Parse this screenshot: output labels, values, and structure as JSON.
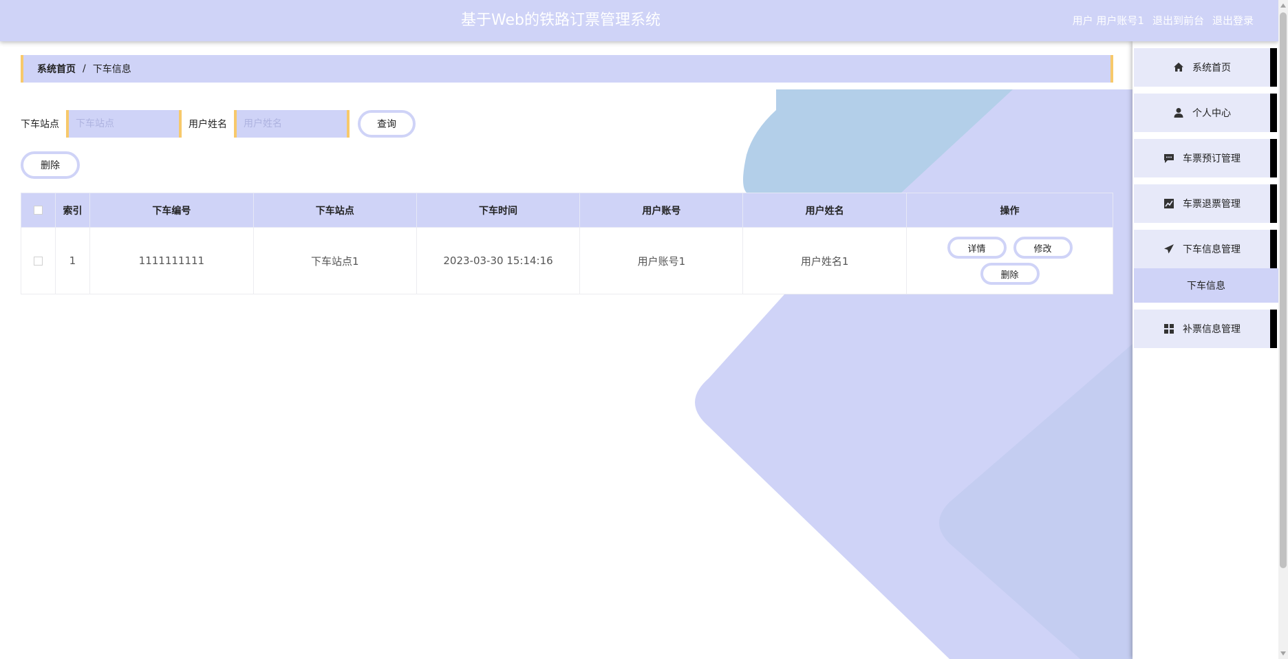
{
  "header": {
    "title": "基于Web的铁路订票管理系统",
    "user_label": "用户 用户账号1",
    "front_link": "退出到前台",
    "logout_link": "退出登录"
  },
  "breadcrumb": {
    "home": "系统首页",
    "separator": "/",
    "current": "下车信息"
  },
  "search": {
    "station_label": "下车站点",
    "station_placeholder": "下车站点",
    "name_label": "用户姓名",
    "name_placeholder": "用户姓名",
    "query_button": "查询"
  },
  "delete_button": "删除",
  "table": {
    "headers": [
      "索引",
      "下车编号",
      "下车站点",
      "下车时间",
      "用户账号",
      "用户姓名",
      "操作"
    ],
    "rows": [
      {
        "index": "1",
        "number": "1111111111",
        "station": "下车站点1",
        "time": "2023-03-30 15:14:16",
        "account": "用户账号1",
        "name": "用户姓名1",
        "actions": {
          "detail": "详情",
          "edit": "修改",
          "delete": "删除"
        }
      }
    ]
  },
  "sidebar": {
    "items": [
      {
        "label": "系统首页",
        "icon": "home-icon"
      },
      {
        "label": "个人中心",
        "icon": "user-icon"
      },
      {
        "label": "车票预订管理",
        "icon": "chat-icon"
      },
      {
        "label": "车票退票管理",
        "icon": "chart-icon"
      },
      {
        "label": "下车信息管理",
        "icon": "send-icon"
      },
      {
        "label": "补票信息管理",
        "icon": "grid-icon"
      }
    ],
    "submenu": {
      "label": "下车信息"
    }
  },
  "colors": {
    "primary": "#cfd3f7",
    "accent": "#f7c96b",
    "menu_bg": "#e7e9f9",
    "deco_blue": "#b3cfe9",
    "deco_lavender": "#cfd3f7"
  }
}
